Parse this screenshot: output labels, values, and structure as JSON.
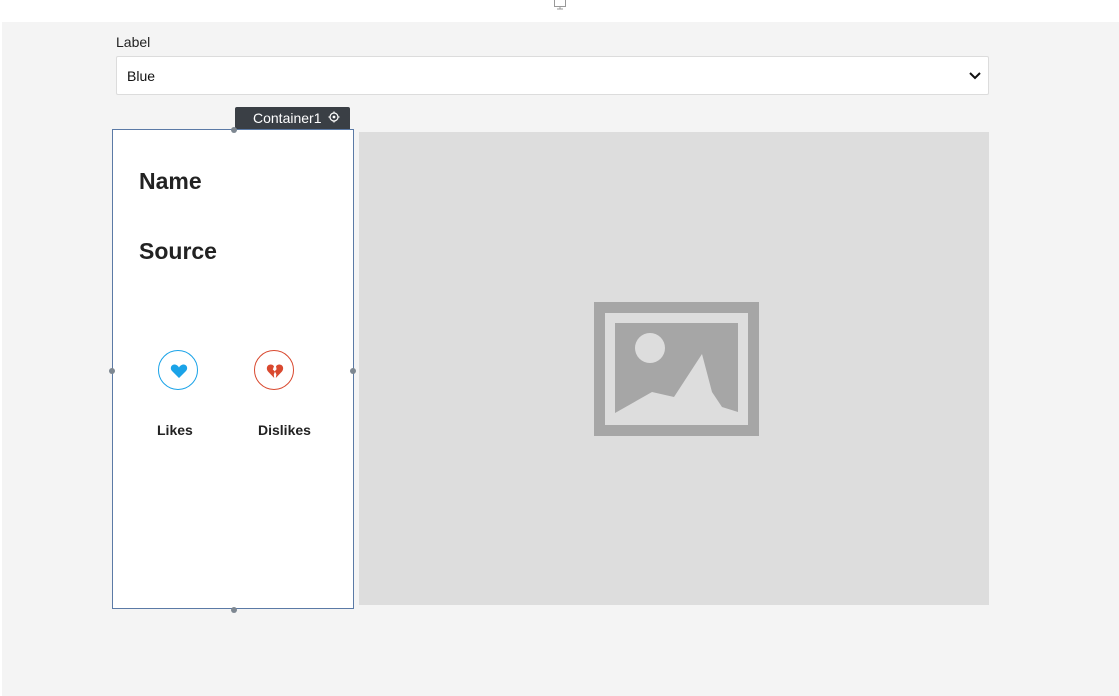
{
  "select": {
    "label": "Label",
    "value": "Blue"
  },
  "container": {
    "tag_label": "Container1"
  },
  "card": {
    "title_name": "Name",
    "title_source": "Source",
    "likes_label": "Likes",
    "dislikes_label": "Dislikes"
  },
  "icons": {
    "top": "monitor-icon",
    "select": "chevron-down-icon",
    "container": "gear-icon",
    "like": "heart-icon",
    "dislike": "broken-heart-icon",
    "image": "image-placeholder-icon"
  },
  "colors": {
    "like": "#1aa3e8",
    "dislike": "#d9492f",
    "selection": "#5b7aa6",
    "tag_bg": "#3a3f45"
  }
}
